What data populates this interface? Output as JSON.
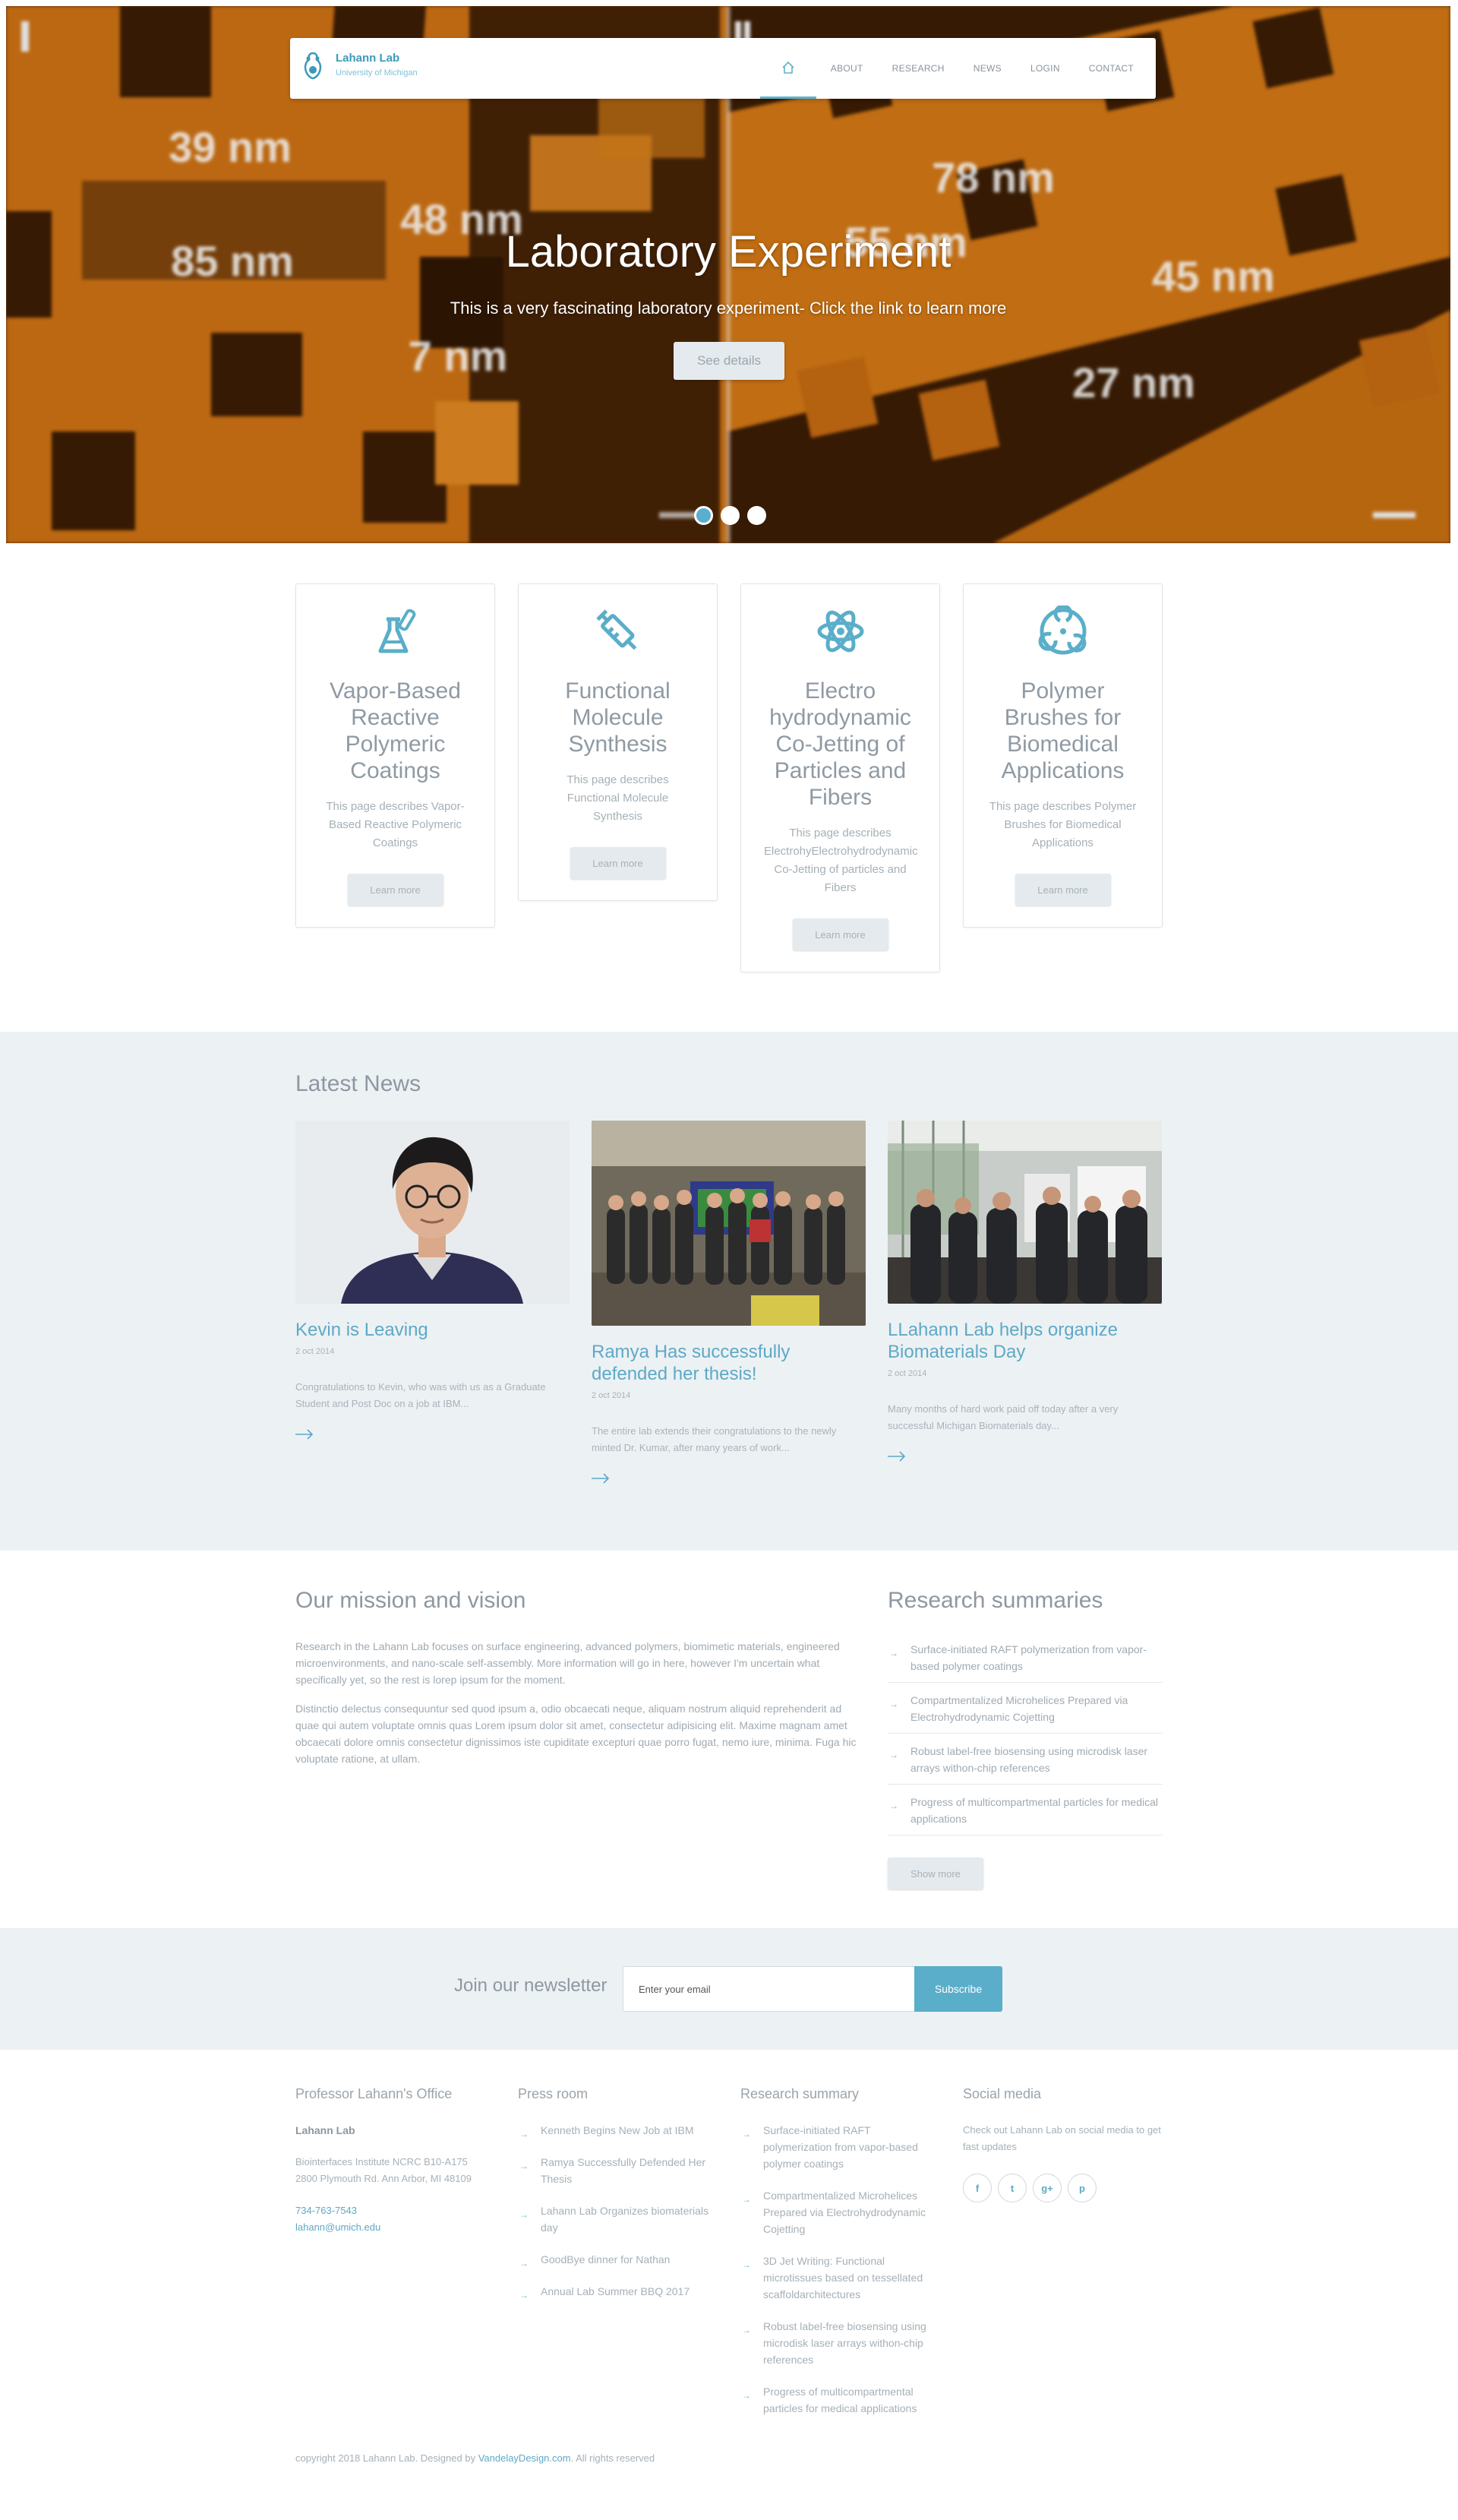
{
  "brand": {
    "name": "Lahann Lab",
    "subtitle": "University of Michigan"
  },
  "nav": {
    "items": [
      "ABOUT",
      "RESEARCH",
      "NEWS",
      "LOGIN",
      "CONTACT"
    ]
  },
  "hero": {
    "title": "Laboratory Experiment",
    "subtitle": "This is a very fascinating laboratory experiment- Click the link to learn more",
    "button": "See details",
    "slides": 3,
    "active_slide": 1,
    "image_labels": [
      "39 nm",
      "48 nm",
      "85 nm",
      "7 nm",
      "78 nm",
      "55 nm",
      "45 nm",
      "27 nm"
    ]
  },
  "cards": [
    {
      "title": "Vapor-Based Reactive Polymeric Coatings",
      "text": "This page describes Vapor-Based Reactive Polymeric Coatings",
      "button": "Learn more",
      "icon": "flask-icon"
    },
    {
      "title": "Functional Molecule Synthesis",
      "text": "This page describes Functional Molecule Synthesis",
      "button": "Learn more",
      "icon": "syringe-icon"
    },
    {
      "title": "Electro hydrodynamic Co-Jetting of Particles and Fibers",
      "text": "This page describes ElectrohyElectrohydrodynamic Co-Jetting of particles and Fibers",
      "button": "Learn more",
      "icon": "atom-icon"
    },
    {
      "title": "Polymer Brushes for Biomedical Applications",
      "text": "This page describes Polymer Brushes for Biomedical Applications",
      "button": "Learn more",
      "icon": "biohazard-icon"
    }
  ],
  "news": {
    "title": "Latest News",
    "items": [
      {
        "headline": "Kevin is Leaving",
        "date": "2 oct 2014",
        "text": "Congratulations to Kevin, who was with us as a Graduate Student and Post Doc on a job at IBM..."
      },
      {
        "headline": "Ramya Has successfully defended her thesis!",
        "date": "2 oct 2014",
        "text": "The entire lab extends their congratulations to the newly minted Dr. Kumar, after many years of work..."
      },
      {
        "headline": "LLahann Lab helps organize Biomaterials Day",
        "date": "2 oct 2014",
        "text": "Many months of hard work paid off today after a very successful Michigan Biomaterials day..."
      }
    ]
  },
  "mission": {
    "title": "Our mission and vision",
    "p1": "Research in the Lahann Lab focuses on surface engineering, advanced polymers, biomimetic materials, engineered microenvironments, and nano-scale self-assembly. More information will go in here, however I'm uncertain what specifically yet, so the rest is lorep ipsum for the moment.",
    "p2": "Distinctio delectus consequuntur sed quod ipsum a, odio obcaecati neque, aliquam nostrum aliquid reprehenderit ad quae qui autem voluptate omnis quas Lorem ipsum dolor sit amet, consectetur adipisicing elit. Maxime magnam amet obcaecati dolore omnis consectetur dignissimos iste cupiditate excepturi quae porro fugat, nemo iure, minima. Fuga hic voluptate ratione, at ullam."
  },
  "summaries": {
    "title": "Research summaries",
    "items": [
      "Surface-initiated RAFT polymerization from vapor-based polymer coatings",
      "Compartmentalized Microhelices Prepared via Electrohydrodynamic Cojetting",
      "Robust label-free biosensing using microdisk laser arrays withon-chip references",
      "Progress of multicompartmental particles for medical applications"
    ],
    "button": "Show more"
  },
  "newsletter": {
    "label": "Join our newsletter",
    "placeholder": "Enter your email",
    "button": "Subscribe"
  },
  "footer": {
    "office": {
      "title": "Professor Lahann's Office",
      "name": "Lahann Lab",
      "address1": "Biointerfaces Institute NCRC B10-A175",
      "address2": "2800 Plymouth Rd. Ann Arbor, MI 48109",
      "phone": "734-763-7543",
      "email": "lahann@umich.edu"
    },
    "press": {
      "title": "Press room",
      "items": [
        "Kenneth Begins New Job at IBM",
        "Ramya Successfully Defended Her Thesis",
        "Lahann Lab Organizes biomaterials day",
        "GoodBye dinner for Nathan",
        "Annual Lab Summer BBQ 2017"
      ]
    },
    "research": {
      "title": "Research summary",
      "items": [
        "Surface-initiated RAFT polymerization from vapor-based polymer coatings",
        "Compartmentalized Microhelices Prepared via Electrohydrodynamic Cojetting",
        "3D Jet Writing: Functional microtissues based on tessellated scaffoldarchitectures",
        "Robust label-free biosensing using microdisk laser arrays withon-chip references",
        "Progress of multicompartmental particles for medical applications"
      ]
    },
    "social": {
      "title": "Social media",
      "text": "Check out Lahann Lab on social media to get fast updates",
      "icons": [
        "f",
        "t",
        "g+",
        "p"
      ]
    },
    "copyright_prefix": "copyright 2018 Lahann Lab. Designed by ",
    "copyright_link": "VandelayDesign.com",
    "copyright_suffix": ". All rights reserved"
  },
  "colors": {
    "accent": "#5aaec9",
    "link": "#5ea9c6",
    "panel": "#ecf1f4",
    "text": "#8a939c"
  }
}
